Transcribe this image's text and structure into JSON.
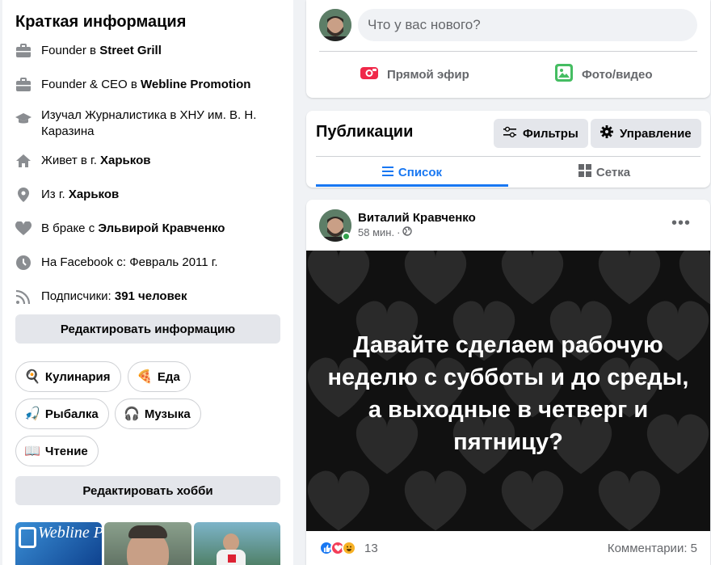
{
  "intro": {
    "title": "Краткая информация",
    "items": [
      {
        "icon": "briefcase-icon",
        "pre": "Founder в ",
        "bold": "Street Grill"
      },
      {
        "icon": "briefcase-icon",
        "pre": "Founder & CEO в ",
        "bold": "Webline Promotion"
      },
      {
        "icon": "graduation-cap-icon",
        "pre": "Изучал Журналистика в ХНУ им. В. Н. Каразина",
        "bold": ""
      },
      {
        "icon": "home-icon",
        "pre": "Живет в г. ",
        "bold": "Харьков"
      },
      {
        "icon": "location-pin-icon",
        "pre": "Из г. ",
        "bold": "Харьков"
      },
      {
        "icon": "heart-icon",
        "pre": "В браке с ",
        "bold": "Эльвирой Кравченко"
      },
      {
        "icon": "clock-icon",
        "pre": "На Facebook с: Февраль 2011 г.",
        "bold": ""
      },
      {
        "icon": "rss-icon",
        "pre": "Подписчики: ",
        "bold": "391 человек"
      }
    ],
    "edit_info_label": "Редактировать информацию",
    "hobbies": [
      {
        "emoji": "🍳",
        "label": "Кулинария"
      },
      {
        "emoji": "🍕",
        "label": "Еда"
      },
      {
        "emoji": "🎣",
        "label": "Рыбалка"
      },
      {
        "emoji": "🎧",
        "label": "Музыка"
      },
      {
        "emoji": "📖",
        "label": "Чтение"
      }
    ],
    "edit_hobbies_label": "Редактировать хобби",
    "photo_logo_text": "Webline Promot"
  },
  "composer": {
    "placeholder": "Что у вас нового?",
    "live_label": "Прямой эфир",
    "photo_label": "Фото/видео"
  },
  "publications": {
    "title": "Публикации",
    "filters_label": "Фильтры",
    "manage_label": "Управление",
    "tab_list": "Список",
    "tab_grid": "Сетка"
  },
  "post": {
    "author": "Виталий Кравченко",
    "time": "58 мин.",
    "text": "Давайте сделаем рабочую неделю с субботы и до среды, а выходные в четверг и пятницу?",
    "reactions_count": "13",
    "comments_label": "Комментарии: 5"
  },
  "colors": {
    "accent": "#1877f2",
    "live_red": "#f02849",
    "photo_green": "#45bd62",
    "online": "#31a24c"
  }
}
